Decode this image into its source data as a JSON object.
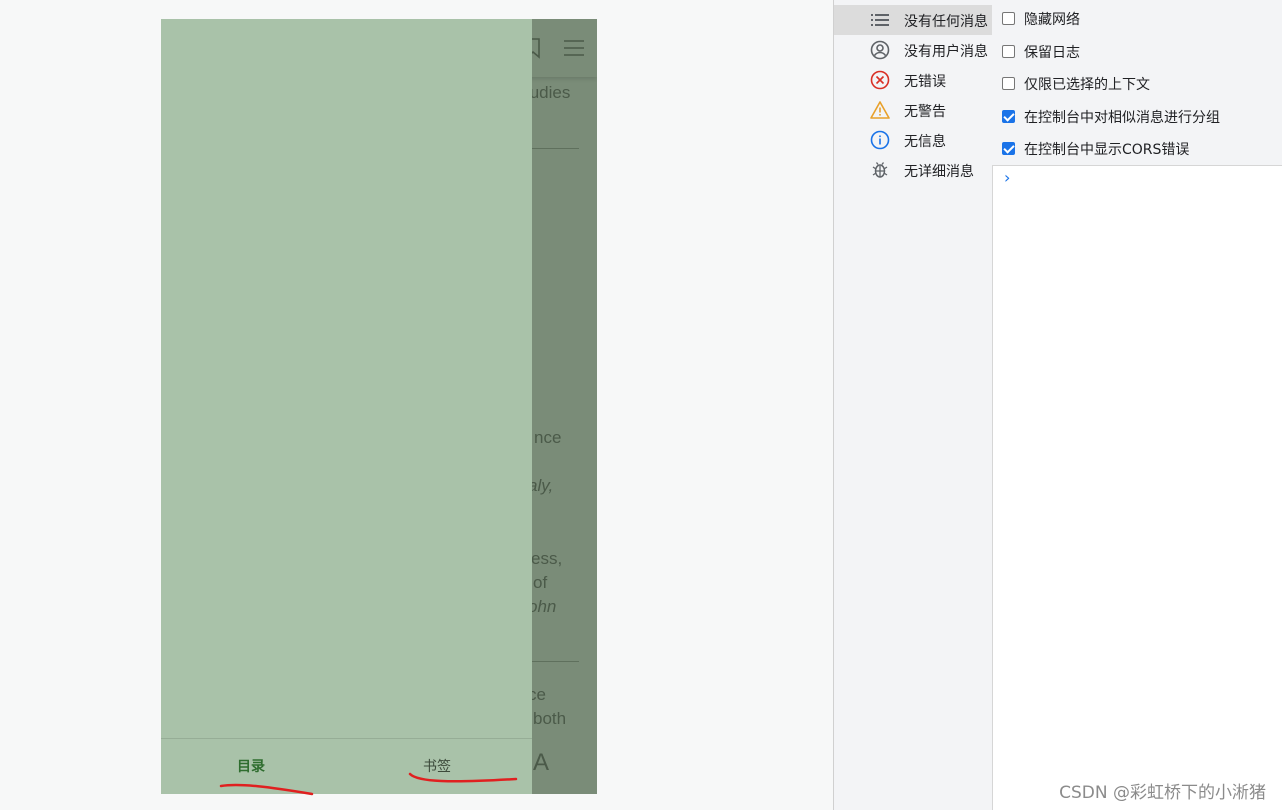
{
  "reader": {
    "fragments": [
      "tudies",
      "nce",
      "aly,",
      "ess,",
      "of",
      "ohn",
      "ce",
      "both"
    ],
    "font_button": "A",
    "drawer": {
      "tabs": [
        {
          "label": "目录",
          "active": true
        },
        {
          "label": "书签",
          "active": false
        }
      ]
    },
    "colors": {
      "drawer": "#a9c2a9",
      "active_tab": "#2f6d2f",
      "annotation": "#e02020"
    }
  },
  "devtools": {
    "sidebar": [
      {
        "label": "没有任何消息",
        "icon": "list-icon",
        "selected": true
      },
      {
        "label": "没有用户消息",
        "icon": "user-circle-icon",
        "selected": false
      },
      {
        "label": "无错误",
        "icon": "error-icon",
        "selected": false
      },
      {
        "label": "无警告",
        "icon": "warning-icon",
        "selected": false
      },
      {
        "label": "无信息",
        "icon": "info-icon",
        "selected": false
      },
      {
        "label": "无详细消息",
        "icon": "bug-icon",
        "selected": false
      }
    ],
    "settings": [
      {
        "label": "隐藏网络",
        "checked": false
      },
      {
        "label": "保留日志",
        "checked": false
      },
      {
        "label": "仅限已选择的上下文",
        "checked": false
      },
      {
        "label": "在控制台中对相似消息进行分组",
        "checked": true
      },
      {
        "label": "在控制台中显示CORS错误",
        "checked": true
      }
    ],
    "prompt": "›"
  },
  "watermark": "CSDN @彩虹桥下的小淅猪"
}
